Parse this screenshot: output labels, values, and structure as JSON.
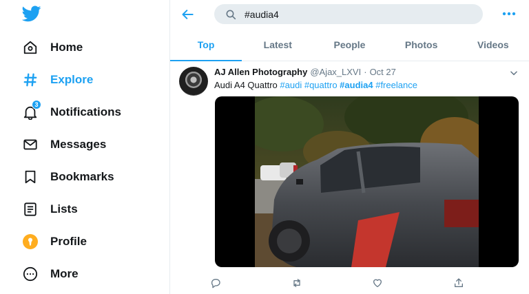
{
  "sidebar": {
    "logo": "twitter-bird-icon",
    "items": [
      {
        "label": "Home",
        "icon": "home-icon"
      },
      {
        "label": "Explore",
        "icon": "hashtag-icon",
        "active": true
      },
      {
        "label": "Notifications",
        "icon": "bell-icon",
        "badge": "3"
      },
      {
        "label": "Messages",
        "icon": "envelope-icon"
      },
      {
        "label": "Bookmarks",
        "icon": "bookmark-icon"
      },
      {
        "label": "Lists",
        "icon": "list-icon"
      },
      {
        "label": "Profile",
        "icon": "profile-icon"
      },
      {
        "label": "More",
        "icon": "more-circle-icon"
      }
    ]
  },
  "search": {
    "value": "#audia4"
  },
  "tabs": [
    {
      "label": "Top",
      "active": true
    },
    {
      "label": "Latest"
    },
    {
      "label": "People"
    },
    {
      "label": "Photos"
    },
    {
      "label": "Videos"
    }
  ],
  "tweet": {
    "author_name": "AJ Allen Photography",
    "author_handle": "@Ajax_LXVI",
    "separator": "·",
    "date": "Oct 27",
    "text_plain": "Audi A4 Quattro",
    "hashtags": [
      "#audi",
      "#quattro",
      "#audia4",
      "#freelance"
    ],
    "media": "photo of a matte grey Audi A4 sedan with a red stripe parked on a wooded road"
  },
  "colors": {
    "accent": "#1da1f2",
    "text": "#14171a",
    "muted": "#657786",
    "search_bg": "#e6ecf0"
  }
}
